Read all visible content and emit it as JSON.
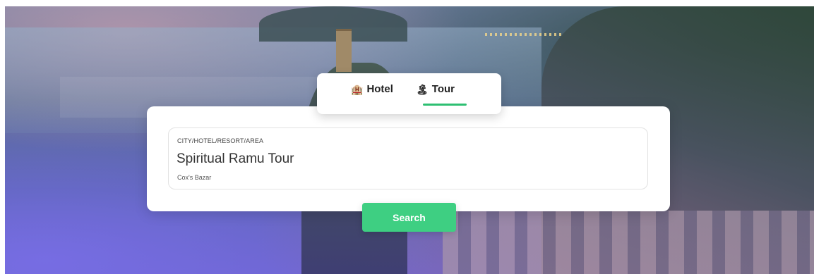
{
  "tabs": {
    "hotel": {
      "label": "Hotel",
      "icon": "building-icon",
      "glyph": "🏨"
    },
    "tour": {
      "label": "Tour",
      "icon": "palm-tree-icon",
      "glyph": "🏝"
    },
    "active": "tour",
    "accent_color": "#2dbf72"
  },
  "search": {
    "field_label": "CITY/HOTEL/RESORT/AREA",
    "value": "Spiritual Ramu Tour",
    "sub_value": "Cox's Bazar",
    "button_label": "Search",
    "button_color": "#3ecf82"
  }
}
